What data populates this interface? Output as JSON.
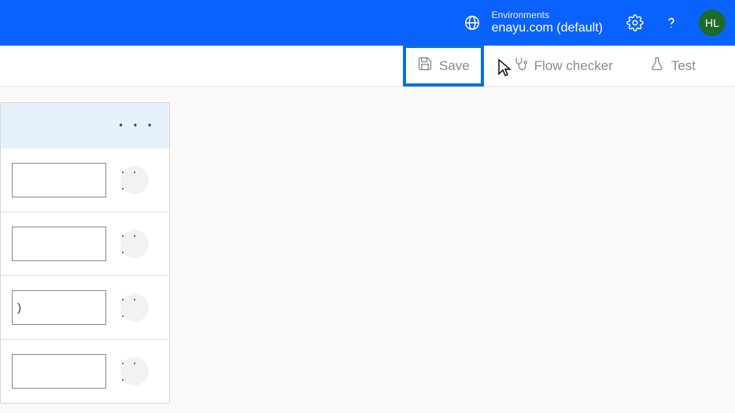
{
  "header": {
    "env_label": "Environments",
    "env_value": "enayu.com (default)",
    "avatar_initials": "HL"
  },
  "toolbar": {
    "save_label": "Save",
    "flow_checker_label": "Flow checker",
    "test_label": "Test"
  },
  "panel": {
    "header_more": "· · ·",
    "rows": [
      {
        "value": "",
        "more": "· · ·"
      },
      {
        "value": "",
        "more": "· · ·"
      },
      {
        "value": ")",
        "more": "· · ·"
      },
      {
        "value": "",
        "more": "· · ·"
      }
    ]
  }
}
